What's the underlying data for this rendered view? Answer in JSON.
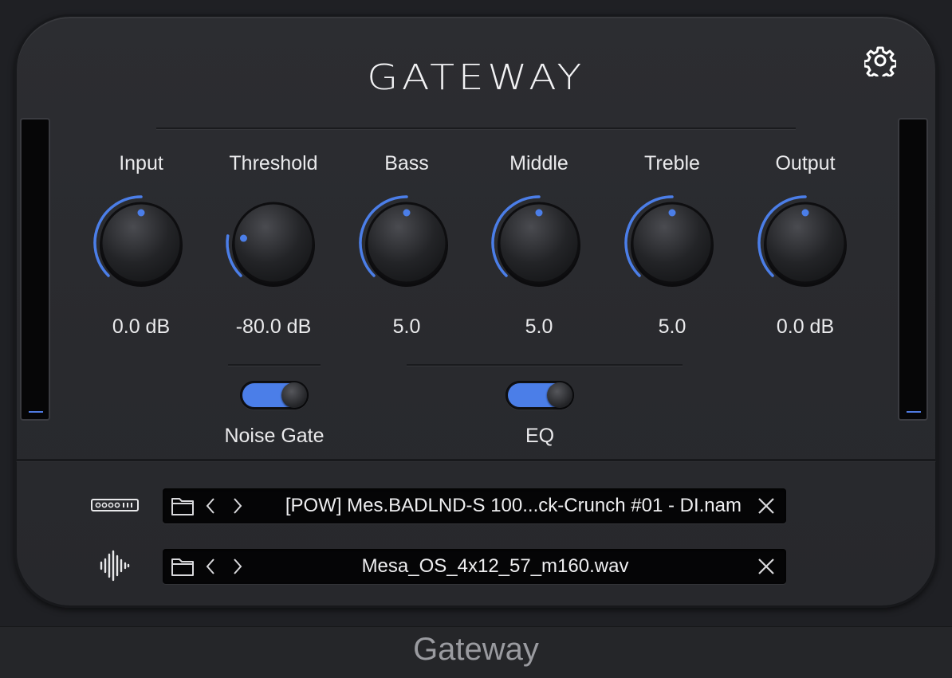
{
  "app": {
    "title": "GATEWAY",
    "footer_title": "Gateway"
  },
  "colors": {
    "accent": "#4b7ee8",
    "panel": "#2b2c30",
    "text": "#eaeaec"
  },
  "icons": {
    "settings": "gear-icon",
    "model": "amp-model-icon",
    "ir": "waveform-icon",
    "folder": "folder-icon",
    "prev": "chevron-left-icon",
    "next": "chevron-right-icon",
    "clear": "close-icon"
  },
  "knobs": [
    {
      "label": "Input",
      "value": "0.0 dB",
      "level": 0.5
    },
    {
      "label": "Threshold",
      "value": "-80.0 dB",
      "level": 0.2
    },
    {
      "label": "Bass",
      "value": "5.0",
      "level": 0.5
    },
    {
      "label": "Middle",
      "value": "5.0",
      "level": 0.5
    },
    {
      "label": "Treble",
      "value": "5.0",
      "level": 0.5
    },
    {
      "label": "Output",
      "value": "0.0 dB",
      "level": 0.5
    }
  ],
  "toggles": [
    {
      "label": "Noise Gate",
      "on": true
    },
    {
      "label": "EQ",
      "on": true
    }
  ],
  "loaders": {
    "model_file": "[POW] Mes.BADLND-S 100...ck-Crunch #01 - DI.nam",
    "ir_file": "Mesa_OS_4x12_57_m160.wav"
  }
}
